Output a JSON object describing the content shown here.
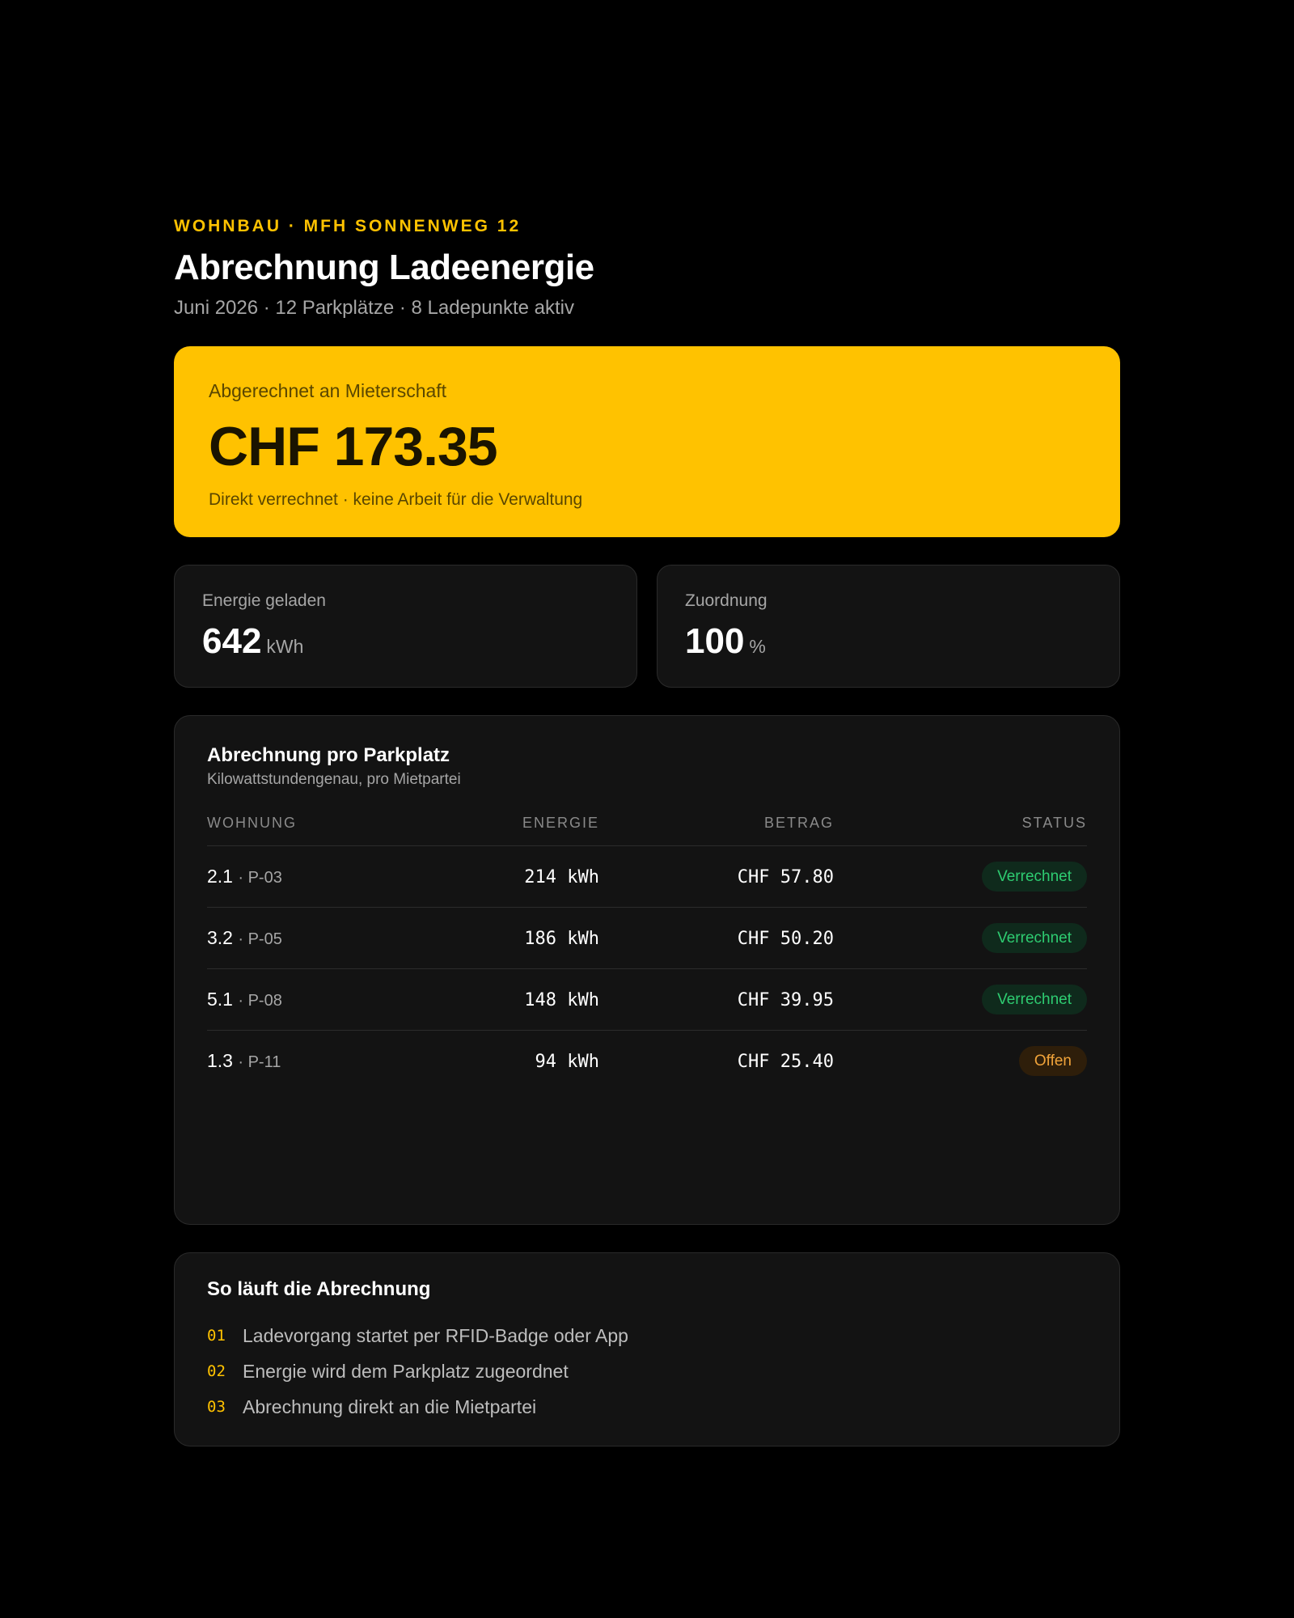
{
  "header": {
    "eyebrow": "WOHNBAU · MFH SONNENWEG 12",
    "title": "Abrechnung Ladeenergie",
    "subtitle": "Juni 2026 · 12 Parkplätze · 8 Ladepunkte aktiv"
  },
  "summary": {
    "label": "Abgerechnet an Mieterschaft",
    "amount": "CHF 173.35",
    "note": "Direkt verrechnet · keine Arbeit für die Verwaltung"
  },
  "stats": [
    {
      "label": "Energie geladen",
      "value": "642",
      "unit": "kWh"
    },
    {
      "label": "Zuordnung",
      "value": "100",
      "unit": "%"
    }
  ],
  "table": {
    "title": "Abrechnung pro Parkplatz",
    "subtitle": "Kilowattstundengenau, pro Mietpartei",
    "columns": {
      "wohnung": "WOHNUNG",
      "energie": "ENERGIE",
      "betrag": "BETRAG",
      "status": "STATUS"
    },
    "rows": [
      {
        "unit": "2.1",
        "spot": "· P-03",
        "energy": "214 kWh",
        "amount": "CHF 57.80",
        "status": "Verrechnet"
      },
      {
        "unit": "3.2",
        "spot": "· P-05",
        "energy": "186 kWh",
        "amount": "CHF 50.20",
        "status": "Verrechnet"
      },
      {
        "unit": "5.1",
        "spot": "· P-08",
        "energy": "148 kWh",
        "amount": "CHF 39.95",
        "status": "Verrechnet"
      },
      {
        "unit": "1.3",
        "spot": "· P-11",
        "energy": "94 kWh",
        "amount": "CHF 25.40",
        "status": "Offen"
      }
    ]
  },
  "steps": {
    "title": "So läuft die Abrechnung",
    "items": [
      {
        "num": "01",
        "text": "Ladevorgang startet per RFID-Badge oder App"
      },
      {
        "num": "02",
        "text": "Energie wird dem Parkplatz zugeordnet"
      },
      {
        "num": "03",
        "text": "Abrechnung direkt an die Mietpartei"
      }
    ]
  },
  "colors": {
    "accent": "#ffc200",
    "background": "#000000",
    "card": "#131313",
    "status_done": "#2ecc71",
    "status_open": "#f0a33a"
  }
}
